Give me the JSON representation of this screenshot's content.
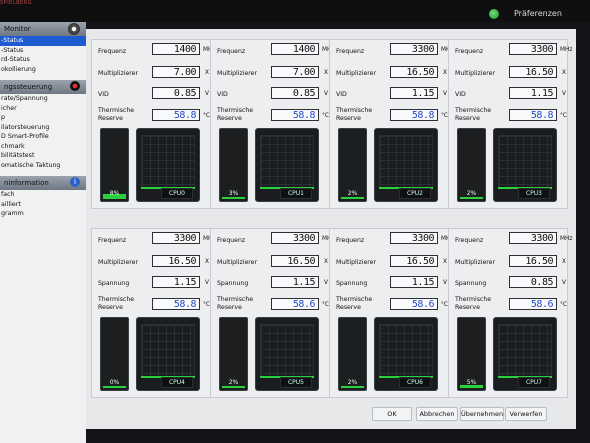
{
  "topbar": {
    "brand": "SPIELBERG",
    "preferences": "Präferenzen"
  },
  "sidebar": {
    "section1": "Monitor",
    "items1": [
      "-Status",
      "-Status",
      "rd-Status",
      "okollierung"
    ],
    "section2": "ngssteuerung",
    "items2": [
      "rate/Spannung",
      "icher",
      "p",
      "ilatorsteuerung",
      "D Smart-Profile",
      "chmark",
      "bilitätstest",
      "omatische Taktung"
    ],
    "section3": "ninformation",
    "items3": [
      "fach",
      "ailliert",
      "gramm"
    ]
  },
  "labels": {
    "freq": "Frequenz",
    "mult": "Multiplizierer",
    "vid": "VID",
    "spannung": "Spannung",
    "thermal1": "Thermische",
    "thermal2": "Reserve",
    "unit_mhz": "MHz",
    "unit_x": "X",
    "unit_v": "V",
    "unit_c": "°C"
  },
  "cores": [
    {
      "name": "CPU0",
      "freq": "1400",
      "mult": "7.00",
      "volt": "0.85",
      "temp": "58.8",
      "load": "8%",
      "load_value": 8
    },
    {
      "name": "CPU1",
      "freq": "1400",
      "mult": "7.00",
      "volt": "0.85",
      "temp": "58.8",
      "load": "3%",
      "load_value": 3
    },
    {
      "name": "CPU2",
      "freq": "3300",
      "mult": "16.50",
      "volt": "1.15",
      "temp": "58.8",
      "load": "2%",
      "load_value": 2
    },
    {
      "name": "CPU3",
      "freq": "3300",
      "mult": "16.50",
      "volt": "1.15",
      "temp": "58.8",
      "load": "2%",
      "load_value": 2
    },
    {
      "name": "CPU4",
      "freq": "3300",
      "mult": "16.50",
      "volt": "1.15",
      "temp": "58.8",
      "load": "0%",
      "load_value": 0
    },
    {
      "name": "CPU5",
      "freq": "3300",
      "mult": "16.50",
      "volt": "1.15",
      "temp": "58.6",
      "load": "2%",
      "load_value": 2
    },
    {
      "name": "CPU6",
      "freq": "3300",
      "mult": "16.50",
      "volt": "1.15",
      "temp": "58.6",
      "load": "2%",
      "load_value": 2
    },
    {
      "name": "CPU7",
      "freq": "3300",
      "mult": "16.50",
      "volt": "0.85",
      "temp": "58.6",
      "load": "5%",
      "load_value": 5
    }
  ],
  "buttons": {
    "ok": "OK",
    "cancel": "Abbrechen",
    "apply": "Übernehmen",
    "discard": "Verwerfen"
  }
}
